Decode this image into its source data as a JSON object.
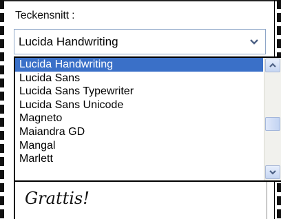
{
  "font_dialog": {
    "label": "Teckensnitt :",
    "selected_font": "Lucida Handwriting",
    "options": [
      "Lucida Handwriting",
      "Lucida Sans",
      "Lucida Sans Typewriter",
      "Lucida Sans Unicode",
      "Magneto",
      "Maiandra GD",
      "Mangal",
      "Marlett"
    ],
    "preview_text": "Grattis!"
  },
  "colors": {
    "selection": "#3a70c8",
    "scrollbar_button": "#c6d6f2"
  },
  "icons": {
    "dropdown": "chevron-down-icon",
    "scroll_up": "scroll-up-icon",
    "scroll_down": "scroll-down-icon"
  }
}
